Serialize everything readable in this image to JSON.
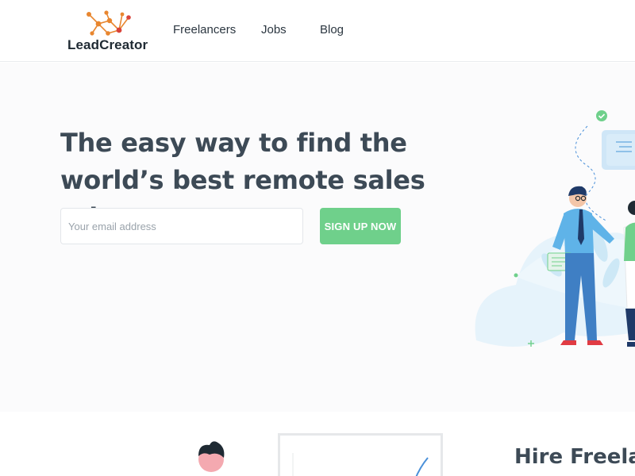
{
  "brand": {
    "name": "LeadCreator",
    "logo_colors": [
      "#e8862f",
      "#d9433a"
    ]
  },
  "nav": {
    "items": [
      "Freelancers",
      "Jobs",
      "Blog"
    ]
  },
  "hero": {
    "title": "The easy way to find the world’s best remote sales talent",
    "email": {
      "placeholder": "Your email address",
      "value": ""
    },
    "signup_label": "SIGN UP NOW"
  },
  "section": {
    "title": "Hire Freela"
  },
  "colors": {
    "accent": "#6fd08b",
    "text": "#3d4a56",
    "illustration_blue": "#4a90d9"
  },
  "icons": [
    "logo-network-icon",
    "checkmark-icon",
    "plus-icon"
  ]
}
